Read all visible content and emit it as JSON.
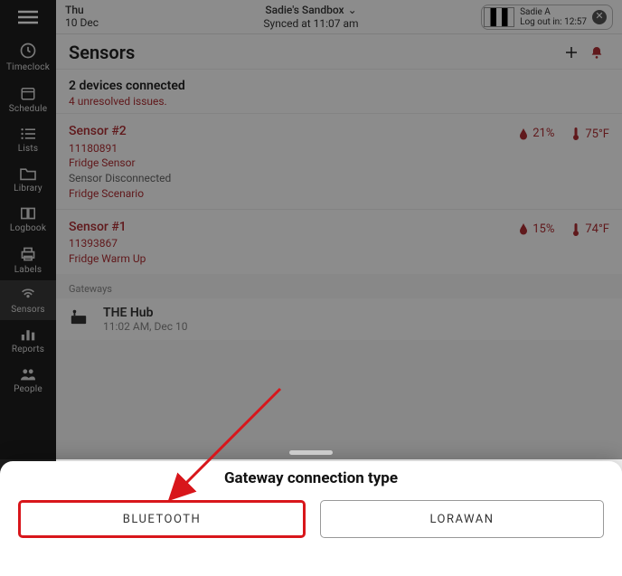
{
  "header": {
    "day": "Thu",
    "date": "10 Dec",
    "location": "Sadie's Sandbox",
    "synced": "Synced at 11:07 am",
    "user_name": "Sadie A",
    "logout": "Log out in: 12:57"
  },
  "page": {
    "title": "Sensors",
    "devices_connected": "2 devices connected",
    "issues": "4 unresolved issues.",
    "gateways_label": "Gateways"
  },
  "sidebar": {
    "items": [
      {
        "label": "Timeclock"
      },
      {
        "label": "Schedule"
      },
      {
        "label": "Lists"
      },
      {
        "label": "Library"
      },
      {
        "label": "Logbook"
      },
      {
        "label": "Labels"
      },
      {
        "label": "Sensors"
      },
      {
        "label": "Reports"
      },
      {
        "label": "People"
      }
    ]
  },
  "sensors": [
    {
      "name": "Sensor #2",
      "id": "11180891",
      "type": "Fridge Sensor",
      "disconnected": "Sensor Disconnected",
      "scenario": "Fridge Scenario",
      "humidity": "21%",
      "temp": "75°F"
    },
    {
      "name": "Sensor #1",
      "id": "11393867",
      "type": "Fridge Warm Up",
      "humidity": "15%",
      "temp": "74°F"
    }
  ],
  "gateway": {
    "name": "THE Hub",
    "time": "11:02 AM, Dec 10"
  },
  "sheet": {
    "title": "Gateway connection type",
    "option_bluetooth": "BLUETOOTH",
    "option_lorawan": "LORAWAN"
  }
}
